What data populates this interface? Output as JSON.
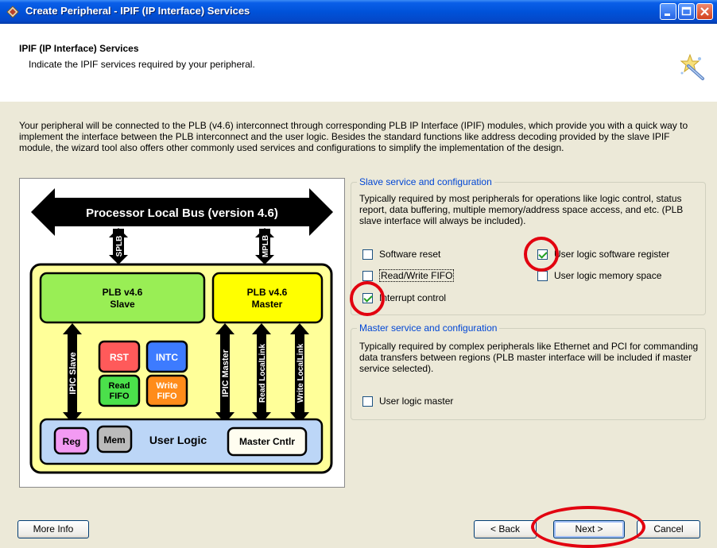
{
  "window": {
    "title": "Create Peripheral - IPIF (IP Interface) Services"
  },
  "header": {
    "title": "IPIF (IP Interface) Services",
    "subtitle": "Indicate the IPIF services required by your peripheral."
  },
  "description": "Your peripheral will be connected to the PLB (v4.6) interconnect through corresponding PLB IP Interface (IPIF) modules, which provide you with a quick way to implement the interface between the PLB interconnect and the user logic. Besides the standard functions like address decoding provided by the slave IPIF module, the wizard tool also offers other commonly used services and configurations to simplify the implementation of the design.",
  "diagram": {
    "bus_label": "Processor Local Bus (version 4.6)",
    "splb": "SPLB",
    "mplb": "MPLB",
    "slave_line1": "PLB v4.6",
    "slave_line2": "Slave",
    "master_line1": "PLB v4.6",
    "master_line2": "Master",
    "ipic_slave": "IPIC Slave",
    "ipic_master": "IPIC Master",
    "read_locallink": "Read LocalLink",
    "write_locallink": "Write LocalLink",
    "rst": "RST",
    "intc": "INTC",
    "read_fifo_1": "Read",
    "read_fifo_2": "FIFO",
    "write_fifo_1": "Write",
    "write_fifo_2": "FIFO",
    "reg": "Reg",
    "mem": "Mem",
    "user_logic": "User Logic",
    "master_cntlr": "Master Cntlr"
  },
  "slave_section": {
    "legend": "Slave service and configuration",
    "text": "Typically required by most peripherals for operations like logic control, status report, data buffering, multiple memory/address space access, and etc. (PLB slave interface will always be included).",
    "options": {
      "software_reset": {
        "label": "Software reset",
        "checked": false
      },
      "user_logic_software_register": {
        "label": "User logic software register",
        "checked": true
      },
      "read_write_fifo": {
        "label": "Read/Write FIFO",
        "checked": false
      },
      "user_logic_memory_space": {
        "label": "User logic memory space",
        "checked": false
      },
      "interrupt_control": {
        "label": "Interrupt control",
        "checked": true
      }
    }
  },
  "master_section": {
    "legend": "Master service and configuration",
    "text": "Typically required by complex peripherals like Ethernet and PCI for commanding data transfers between regions (PLB master interface will be included if master service selected).",
    "options": {
      "user_logic_master": {
        "label": "User logic master",
        "checked": false
      }
    }
  },
  "buttons": {
    "more_info": "More Info",
    "back": "< Back",
    "next": "Next >",
    "cancel": "Cancel"
  },
  "colors": {
    "titlebar": "#0052d9",
    "slave_box": "#99ee55",
    "master_box": "#ffff00",
    "user_logic_box": "#bcd6f7",
    "annotation_circle": "#e2000f"
  }
}
